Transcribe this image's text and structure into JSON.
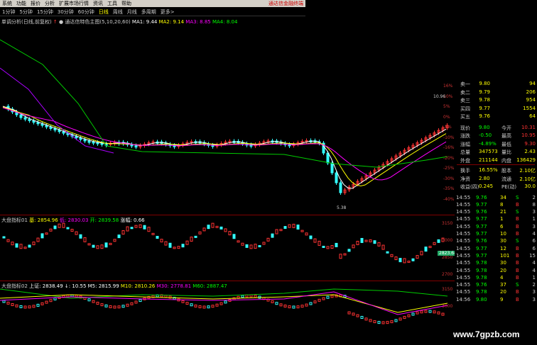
{
  "menubar": {
    "items": [
      "系统",
      "功能",
      "报价",
      "分析",
      "扩展市场行情",
      "资讯",
      "工具",
      "帮助"
    ],
    "alert": "通达信金融终端"
  },
  "periods": {
    "items": [
      "1分钟",
      "5分钟",
      "15分钟",
      "30分钟",
      "60分钟",
      "日线",
      "周线",
      "月线",
      "多周期",
      "更多>"
    ],
    "active": "日线"
  },
  "chart": {
    "indicator_title": "单调分析(日线,前复权)",
    "indicator_name": "通达信特色主图(5,10,20,60)",
    "ma": [
      {
        "label": "MA1: 9.44",
        "color": "#ffffff"
      },
      {
        "label": "MA2: 9.14",
        "color": "#ffff00"
      },
      {
        "label": "MA3: 8.85",
        "color": "#ff00ff"
      },
      {
        "label": "MA4: 8.04",
        "color": "#00ff00"
      }
    ],
    "high_label": "10.96",
    "low_label": "5.38",
    "pct_labels": [
      "16%",
      "10%",
      "5%",
      "0%",
      "-5%",
      "-10%",
      "-16%",
      "-20%",
      "-25%",
      "-30%",
      "-35%",
      "-40%"
    ]
  },
  "sub1": {
    "title": "大盘指标01",
    "items": [
      {
        "label": "基: 2854.96",
        "color": "#ffff00"
      },
      {
        "label": "低: 2830.03",
        "color": "#ff00ff"
      },
      {
        "label": "开: 2839.58",
        "color": "#00ff00"
      },
      {
        "label": "涨幅: 0.66",
        "color": "#ffffff"
      }
    ],
    "axis": [
      "3150",
      "3000",
      "2850",
      "2700"
    ],
    "tag": "2823.64"
  },
  "sub2": {
    "title": "大盘指标02",
    "items": [
      {
        "label": "上证: 2838.49",
        "color": "#ffffff"
      },
      {
        "label": "↓: 10.55",
        "color": "#ffffff"
      },
      {
        "label": "M5: 2815.99",
        "color": "#ffffff"
      },
      {
        "label": "M10: 2810.26",
        "color": "#ffff00"
      },
      {
        "label": "M30: 2778.81",
        "color": "#ff00ff"
      },
      {
        "label": "M60: 2887.47",
        "color": "#00ff00"
      }
    ],
    "axis": [
      "3150",
      "3000"
    ]
  },
  "quote": {
    "book": [
      {
        "label": "卖一",
        "price": "9.80",
        "vol": "94"
      },
      {
        "label": "卖二",
        "price": "9.79",
        "vol": "206"
      },
      {
        "label": "卖三",
        "price": "9.78",
        "vol": "954"
      },
      {
        "label": "买四",
        "price": "9.77",
        "vol": "1554"
      },
      {
        "label": "买五",
        "price": "9.76",
        "vol": "64"
      }
    ],
    "stats": [
      {
        "l1": "现价",
        "v1": "9.80",
        "l2": "今开",
        "v2": "10.31"
      },
      {
        "l1": "涨跌",
        "v1": "-0.50",
        "l2": "最高",
        "v2": "10.95"
      },
      {
        "l1": "涨幅",
        "v1": "-4.89%",
        "l2": "最低",
        "v2": "9.30"
      },
      {
        "l1": "总量",
        "v1": "347573",
        "l2": "量比",
        "v2": "2.43"
      },
      {
        "l1": "外盘",
        "v1": "211144",
        "l2": "内盘",
        "v2": "136429"
      },
      {
        "l1": "换手",
        "v1": "16.55%",
        "l2": "股本",
        "v2": "2.10亿"
      },
      {
        "l1": "净资",
        "v1": "2.80",
        "l2": "流通",
        "v2": "2.10亿"
      },
      {
        "l1": "收益(四)",
        "v1": "0.245",
        "l2": "PE(动)",
        "v2": "30.0"
      }
    ],
    "ticks": [
      {
        "t": "14:55",
        "p": "9.76",
        "v": "34",
        "s": "S",
        "n": "2"
      },
      {
        "t": "14:55",
        "p": "9.77",
        "v": "8",
        "s": "B",
        "n": "8"
      },
      {
        "t": "14:55",
        "p": "9.76",
        "v": "21",
        "s": "S",
        "n": "3"
      },
      {
        "t": "14:55",
        "p": "9.77",
        "v": "1",
        "s": "B",
        "n": "1"
      },
      {
        "t": "14:55",
        "p": "9.77",
        "v": "6",
        "s": "B",
        "n": "3"
      },
      {
        "t": "14:55",
        "p": "9.77",
        "v": "10",
        "s": "B",
        "n": "4"
      },
      {
        "t": "14:55",
        "p": "9.76",
        "v": "30",
        "s": "S",
        "n": "6"
      },
      {
        "t": "14:55",
        "p": "9.77",
        "v": "12",
        "s": "B",
        "n": "6"
      },
      {
        "t": "14:55",
        "p": "9.77",
        "v": "101",
        "s": "B",
        "n": "15"
      },
      {
        "t": "14:55",
        "p": "9.78",
        "v": "30",
        "s": "B",
        "n": "4"
      },
      {
        "t": "14:55",
        "p": "9.78",
        "v": "20",
        "s": "B",
        "n": "4"
      },
      {
        "t": "14:55",
        "p": "9.78",
        "v": "4",
        "s": "B",
        "n": "1"
      },
      {
        "t": "14:55",
        "p": "9.76",
        "v": "37",
        "s": "S",
        "n": "2"
      },
      {
        "t": "14:55",
        "p": "9.78",
        "v": "20",
        "s": "B",
        "n": "3"
      },
      {
        "t": "14:56",
        "p": "9.80",
        "v": "9",
        "s": "B",
        "n": "3"
      }
    ]
  },
  "watermark": "www.7gpzb.com"
}
